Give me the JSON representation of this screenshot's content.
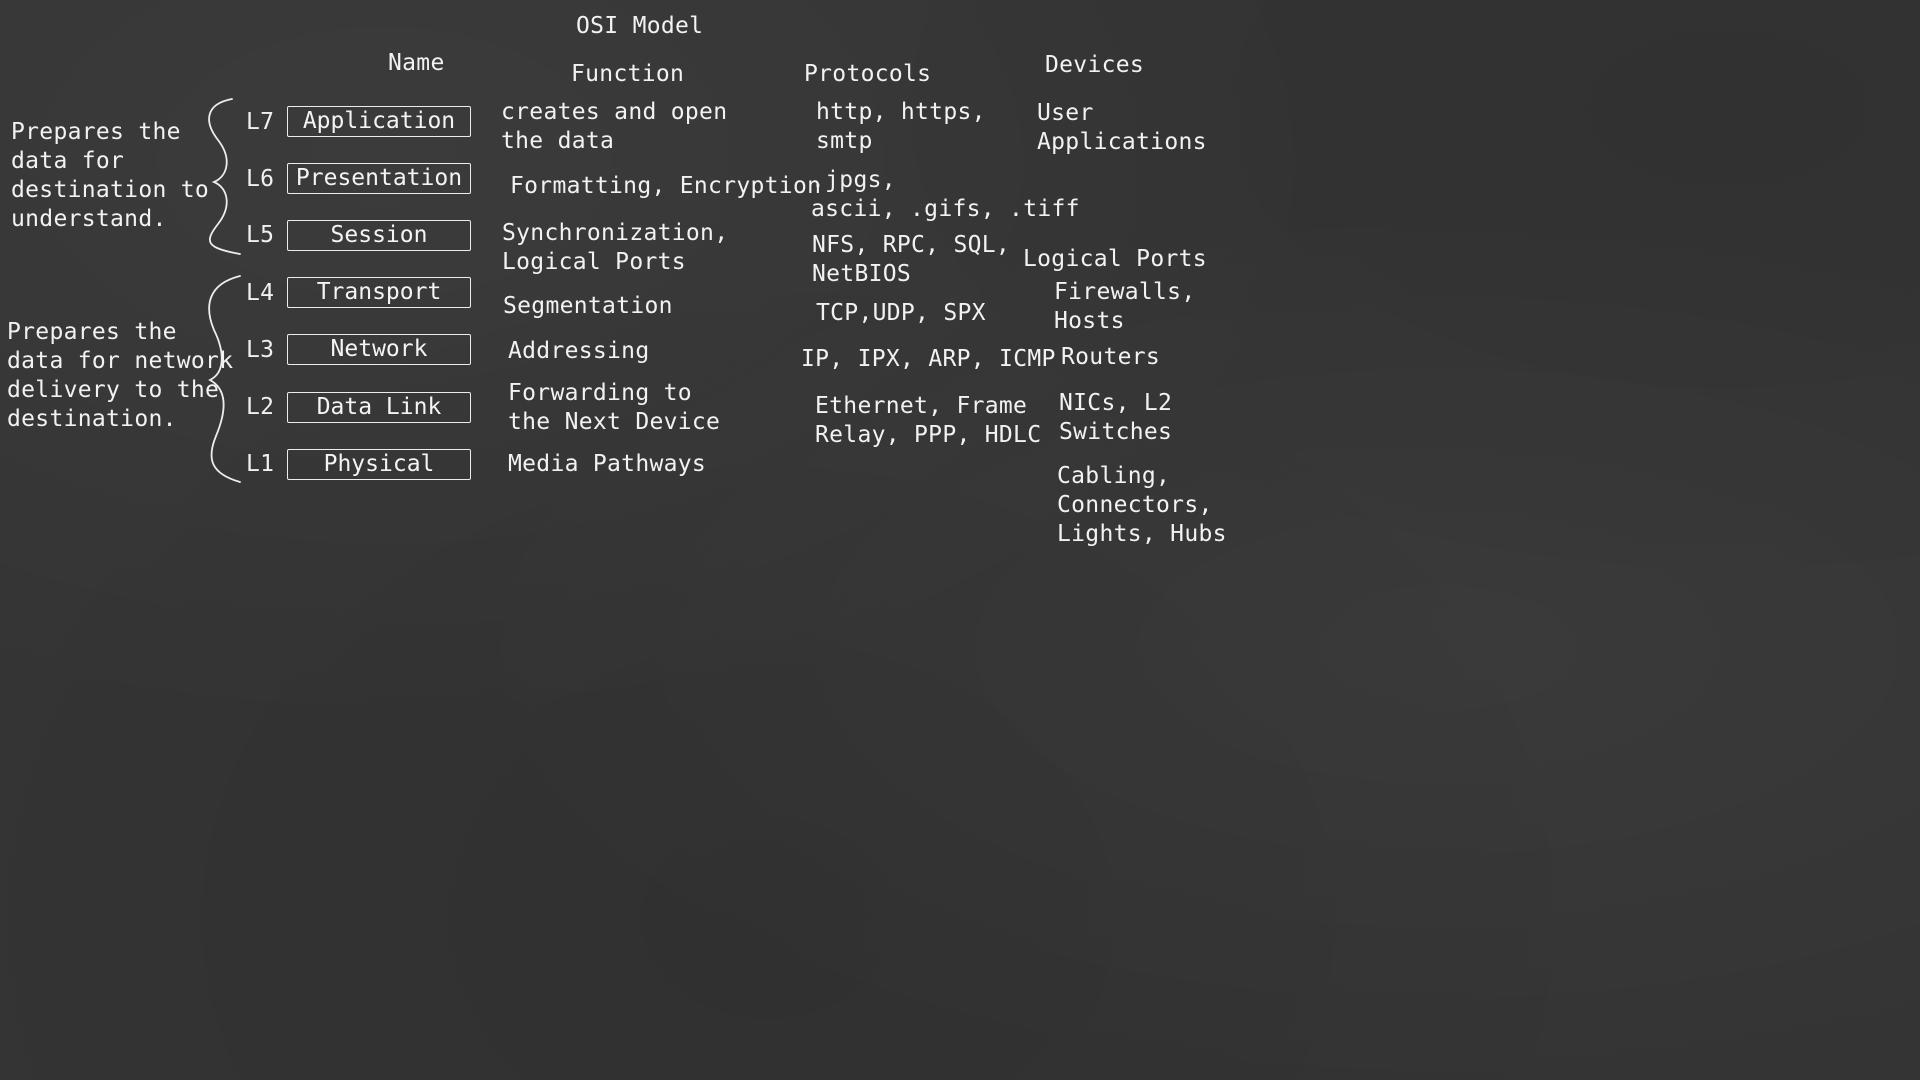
{
  "title": "OSI Model",
  "headers": {
    "name": "Name",
    "function": "Function",
    "protocols": "Protocols",
    "devices": "Devices"
  },
  "groups": {
    "upper": "Prepares the\ndata for\ndestination to\nunderstand.",
    "lower": "Prepares the\ndata for network\ndelivery to the\ndestination."
  },
  "layers": [
    {
      "num": "L7",
      "name": "Application",
      "function": "creates and open\nthe data",
      "protocols": "http, https,\nsmtp",
      "devices": "User\nApplications"
    },
    {
      "num": "L6",
      "name": "Presentation",
      "function": "Formatting, Encryption",
      "protocols": ".jpgs,\nascii, .gifs, .tiff",
      "devices": ""
    },
    {
      "num": "L5",
      "name": "Session",
      "function": "Synchronization,\nLogical Ports",
      "protocols": "NFS, RPC, SQL,\nNetBIOS",
      "devices": "Logical Ports"
    },
    {
      "num": "L4",
      "name": "Transport",
      "function": "Segmentation",
      "protocols": "TCP,UDP, SPX",
      "devices": "Firewalls,\nHosts"
    },
    {
      "num": "L3",
      "name": "Network",
      "function": "Addressing",
      "protocols": "IP, IPX, ARP, ICMP",
      "devices": "Routers"
    },
    {
      "num": "L2",
      "name": "Data Link",
      "function": "Forwarding to\nthe Next Device",
      "protocols": "Ethernet, Frame\nRelay, PPP, HDLC",
      "devices": "NICs, L2\nSwitches"
    },
    {
      "num": "L1",
      "name": "Physical",
      "function": "Media Pathways",
      "protocols": "",
      "devices": "Cabling,\nConnectors,\nLights, Hubs"
    }
  ]
}
